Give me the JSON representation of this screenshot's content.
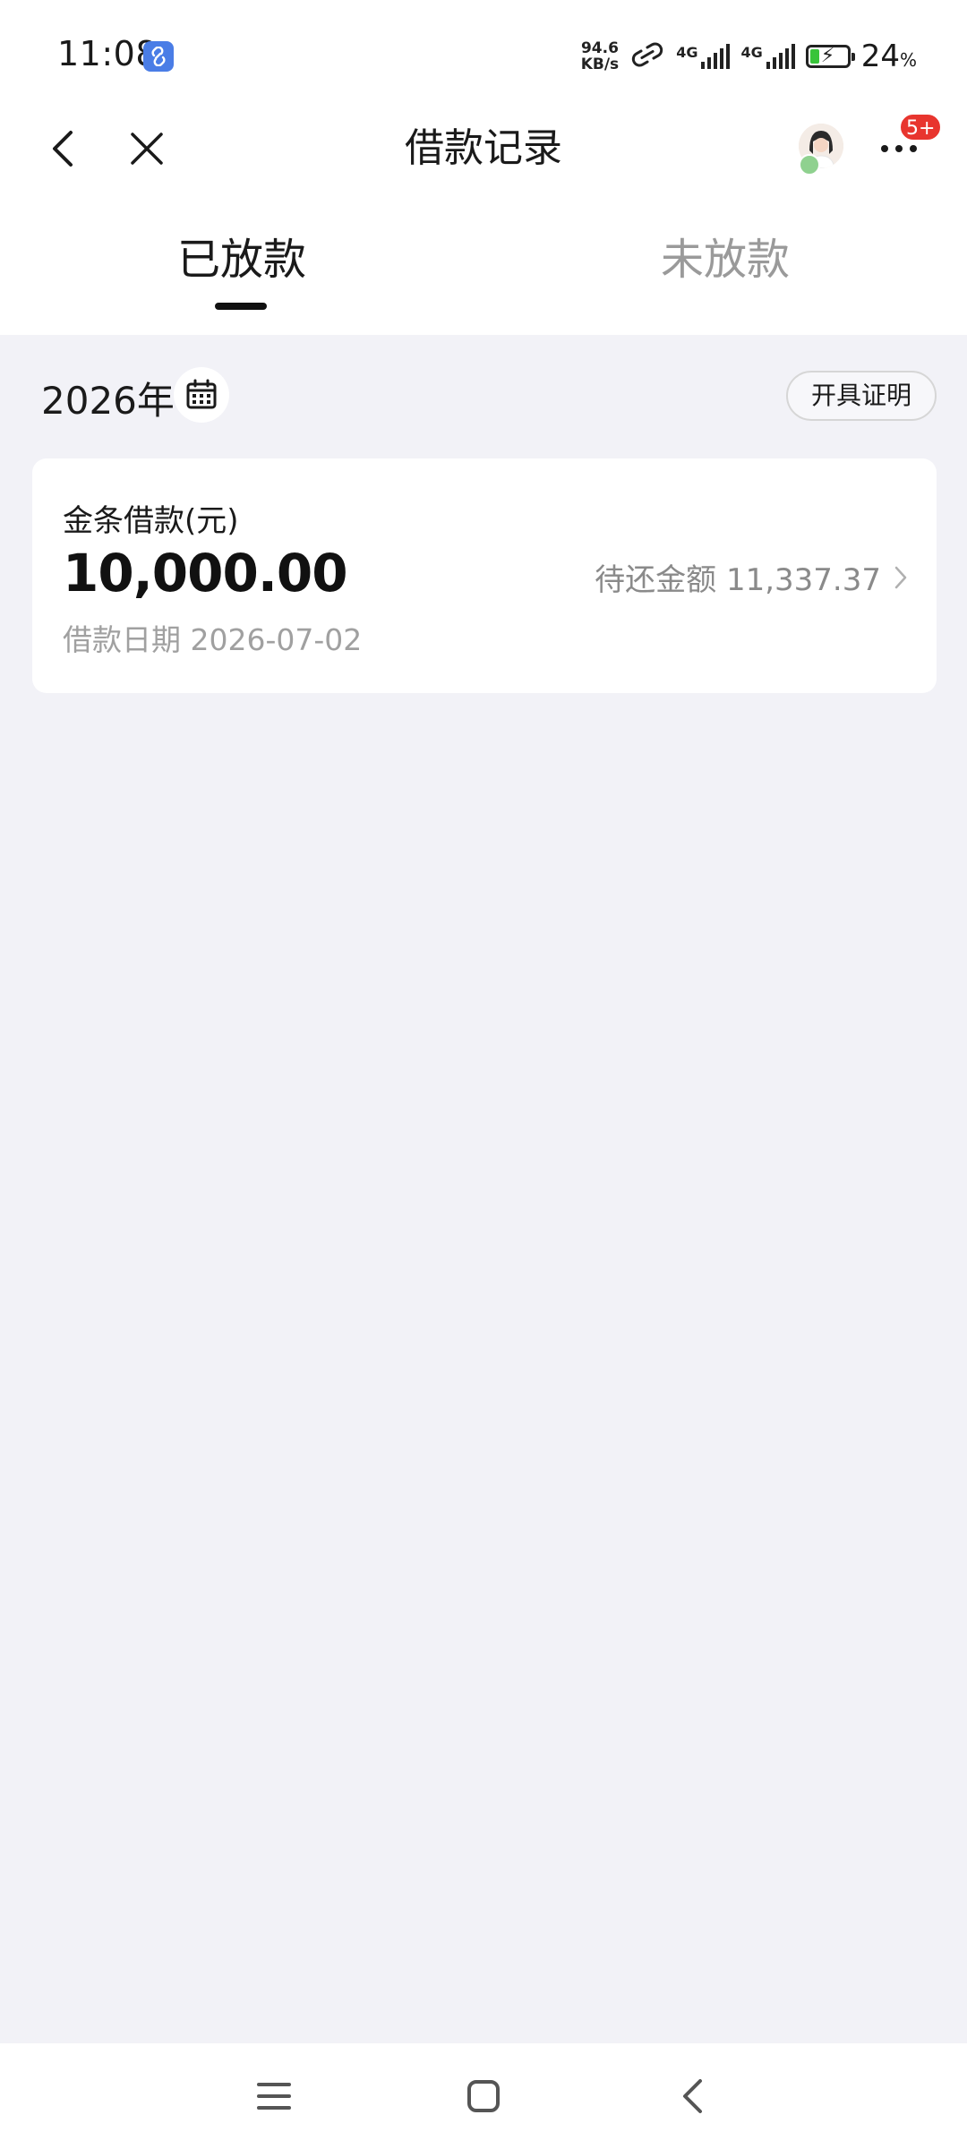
{
  "status_bar": {
    "time": "11:08",
    "net_speed_value": "94.6",
    "net_speed_unit": "KB/s",
    "signal1_label": "4G",
    "signal2_label": "4G",
    "battery_percent": "24",
    "battery_percent_sign": "%"
  },
  "nav": {
    "title": "借款记录",
    "badge": "5+"
  },
  "tabs": [
    {
      "label": "已放款",
      "active": true
    },
    {
      "label": "未放款",
      "active": false
    }
  ],
  "filter": {
    "year": "2026年",
    "certificate_button": "开具证明"
  },
  "loans": [
    {
      "type": "金条借款(元)",
      "amount": "10,000.00",
      "pending": "待还金额 11,337.37",
      "date": "借款日期 2026-07-02"
    }
  ],
  "colors": {
    "background": "#f2f2f7",
    "badge": "#e8352e",
    "battery_fill": "#38c43a",
    "app_icon": "#4a7de6"
  },
  "icons": [
    "back-icon",
    "close-icon",
    "avatar",
    "more-icon",
    "calendar-icon",
    "chevron-right-icon",
    "menu-icon",
    "home-icon",
    "back-nav-icon"
  ]
}
